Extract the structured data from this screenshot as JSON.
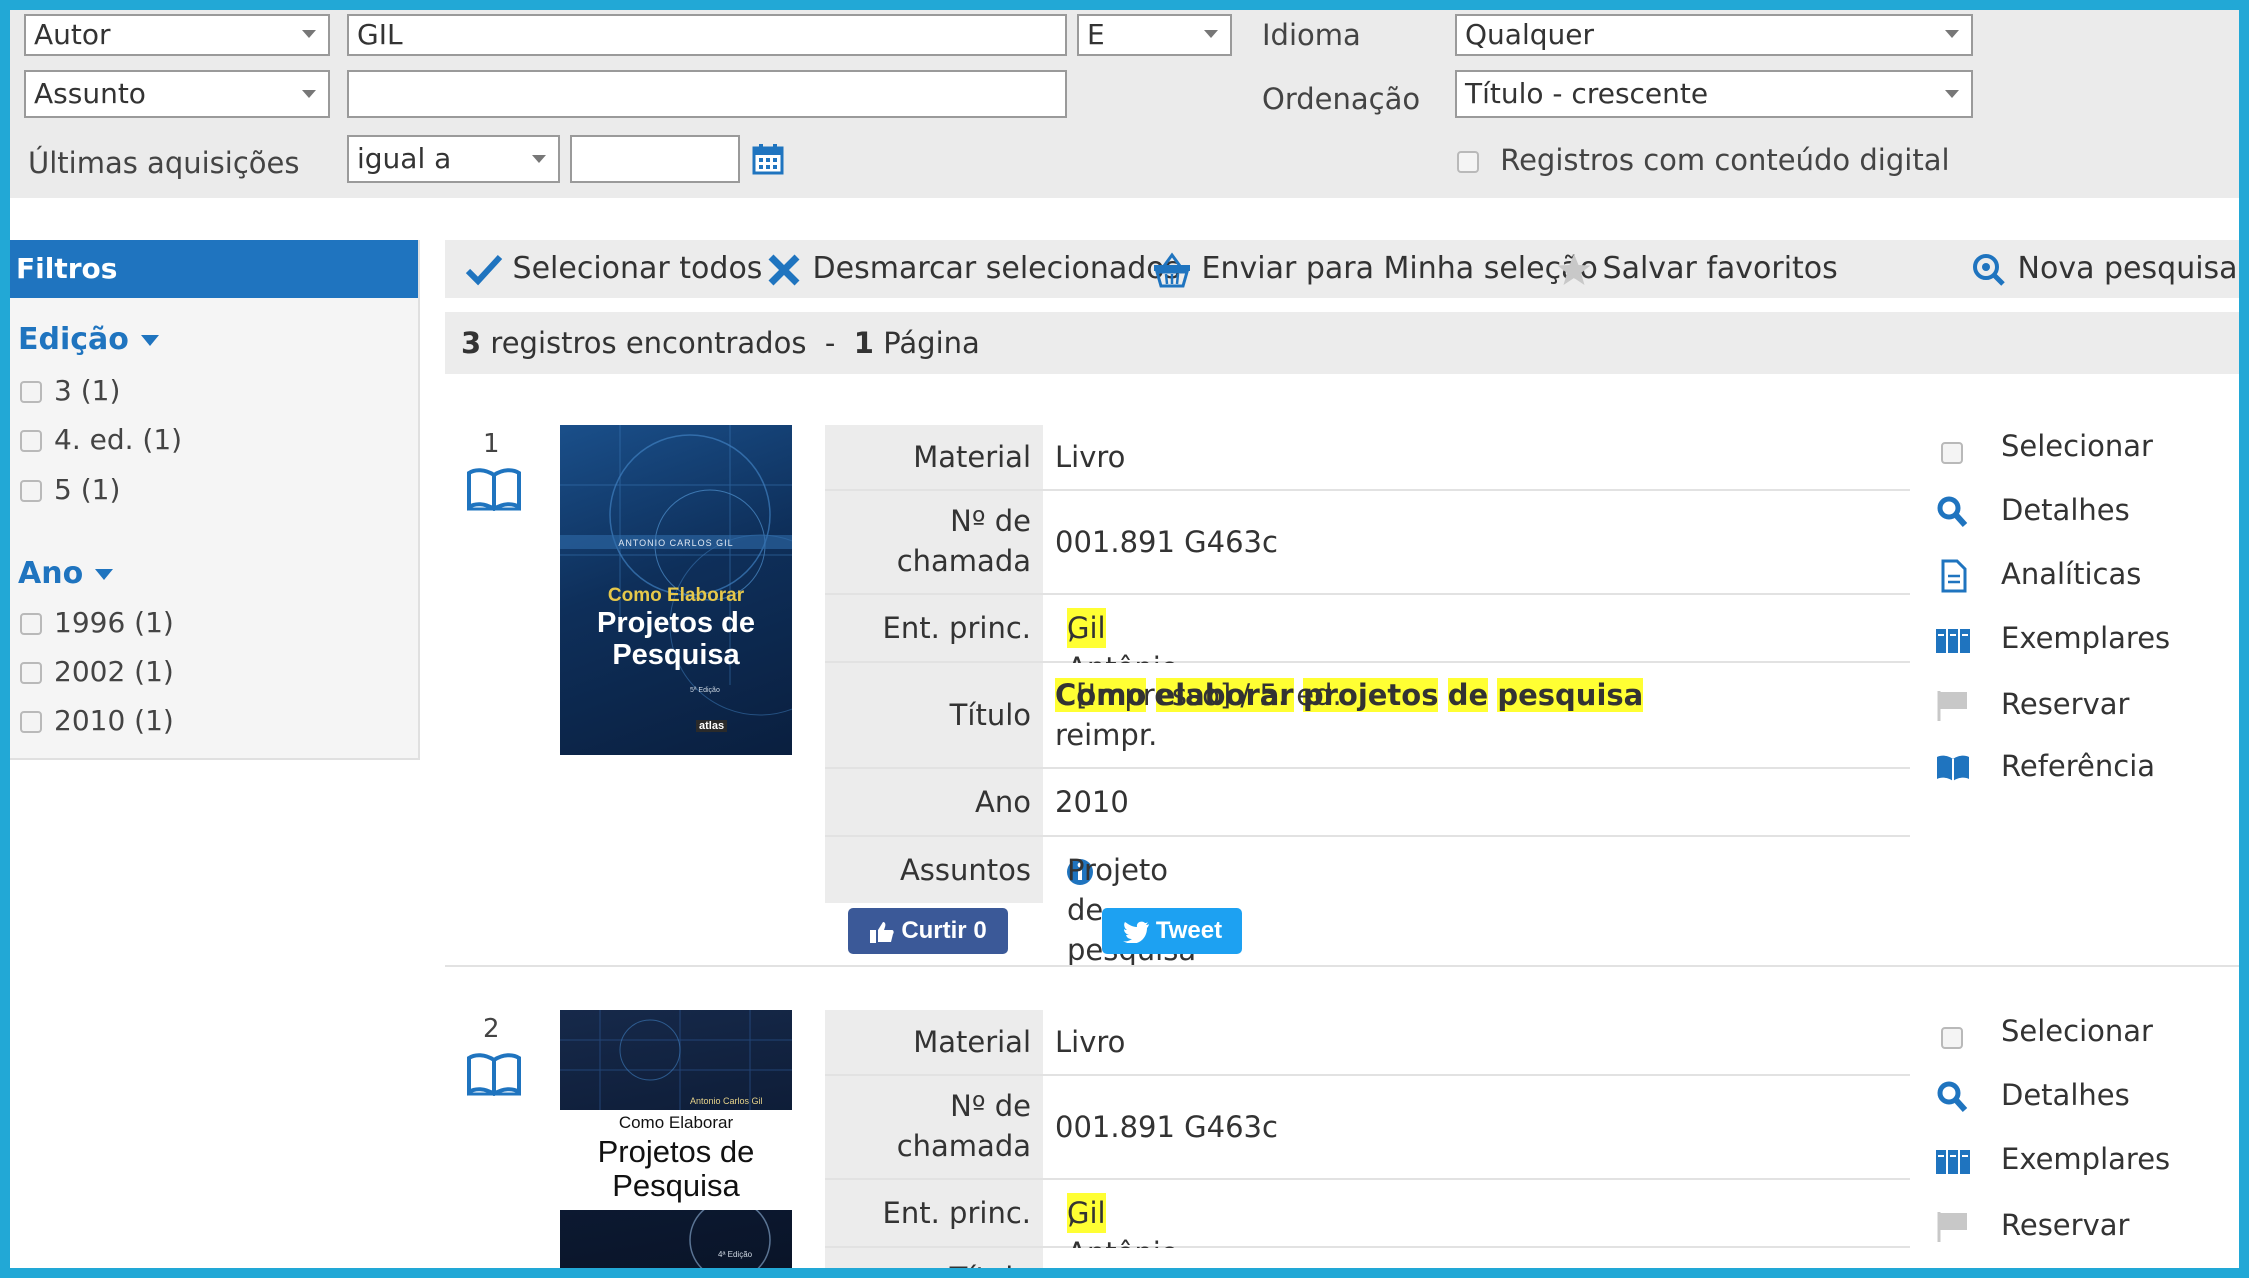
{
  "search": {
    "field1": "Autor",
    "term1": "GIL",
    "operator": "E",
    "field2": "Assunto",
    "term2": "",
    "idioma_label": "Idioma",
    "idioma_value": "Qualquer",
    "ordenacao_label": "Ordenação",
    "ordenacao_value": "Título - crescente",
    "aquisicoes_label": "Últimas aquisições",
    "aquisicoes_op": "igual a",
    "aquisicoes_value": "",
    "digital_label": "Registros com conteúdo digital"
  },
  "filters": {
    "title": "Filtros",
    "groups": [
      {
        "label": "Edição",
        "items": [
          "3 (1)",
          "4. ed. (1)",
          "5 (1)"
        ]
      },
      {
        "label": "Ano",
        "items": [
          "1996 (1)",
          "2002 (1)",
          "2010 (1)"
        ]
      }
    ]
  },
  "toolbar": {
    "select_all": "Selecionar todos",
    "deselect": "Desmarcar selecionados",
    "send": "Enviar para Minha seleção",
    "favorites": "Salvar favoritos",
    "new_search": "Nova pesquisa"
  },
  "results": {
    "count": "3",
    "count_text": " registros encontrados  -  ",
    "pages": "1",
    "pages_text": " Página"
  },
  "records": [
    {
      "num": "1",
      "cover": {
        "author": "ANTONIO CARLOS GIL",
        "title1": "Como Elaborar",
        "title2": "Projetos de",
        "title3": "Pesquisa",
        "edition": "5ª Edição",
        "publisher": "atlas"
      },
      "fields": {
        "material_label": "Material",
        "material": "Livro",
        "chamada_label1": "Nº de",
        "chamada_label2": "chamada",
        "chamada": "001.891 G463c",
        "autor_label": "Ent. princ.",
        "autor_hl": "Gil",
        "autor_rest": ", Antônio Carlos",
        "titulo_label": "Título",
        "titulo_words": [
          "Como",
          "elaborar",
          "projetos",
          "de",
          "pesquisa"
        ],
        "titulo_rest": " [Impresso] / 5. ed.",
        "titulo_line2": "reimpr.",
        "ano_label": "Ano",
        "ano": "2010",
        "assuntos_label": "Assuntos",
        "assuntos": "Projeto de pesquisa"
      },
      "actions": [
        "Selecionar",
        "Detalhes",
        "Analíticas",
        "Exemplares",
        "Reservar",
        "Referência"
      ],
      "social": {
        "like": "Curtir 0",
        "tweet": "Tweet"
      }
    },
    {
      "num": "2",
      "cover": {
        "author": "Antonio Carlos Gil",
        "title1": "Como Elaborar",
        "title2": "Projetos de",
        "title3": "Pesquisa",
        "edition": "4ª Edição"
      },
      "fields": {
        "material_label": "Material",
        "material": "Livro",
        "chamada_label1": "Nº de",
        "chamada_label2": "chamada",
        "chamada": "001.891 G463c",
        "autor_label": "Ent. princ.",
        "autor_hl": "Gil",
        "autor_rest": ", Antônio Carlos",
        "titulo_label": "Título"
      },
      "actions": [
        "Selecionar",
        "Detalhes",
        "Exemplares",
        "Reservar"
      ]
    }
  ],
  "colors": {
    "frame": "#22a8d6",
    "accent": "#1f74bf",
    "highlight": "#ffff33",
    "facebook": "#3b5998",
    "twitter": "#1da1f2"
  }
}
